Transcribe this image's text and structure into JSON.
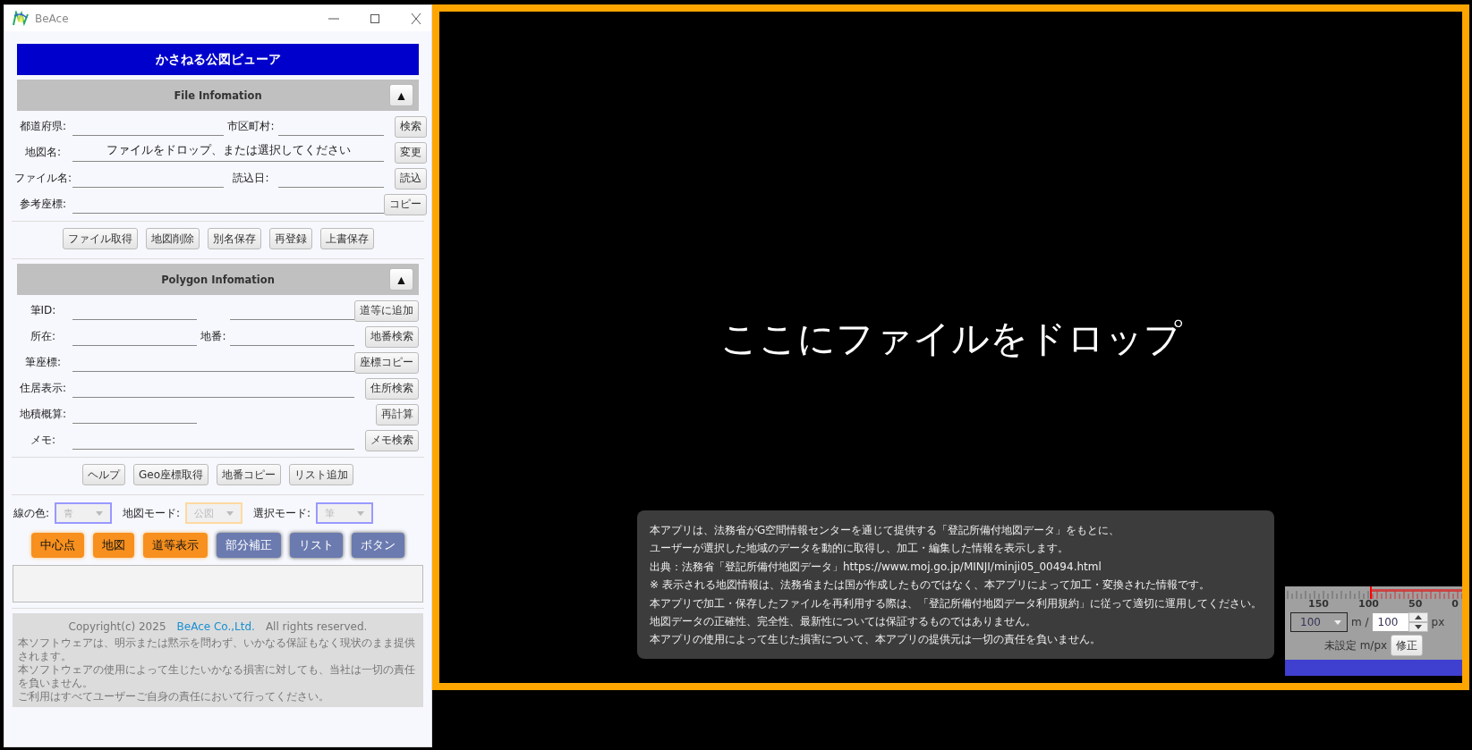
{
  "window": {
    "title": "BeAce"
  },
  "header": "かさねる公図ビューア",
  "sections": [
    {
      "title": "File Infomation",
      "toggle": "▲",
      "expanded": true,
      "rows": [
        {
          "kind": "pair",
          "label": "都道府県:",
          "label_2": "市区町村:",
          "button": "検索"
        },
        {
          "kind": "single",
          "label": "地図名:",
          "value": "ファイルをドロップ、または選択してください",
          "button": "変更"
        },
        {
          "kind": "pair",
          "label": "ファイル名:",
          "label_2": "読込日:",
          "button": "読込"
        },
        {
          "kind": "single",
          "label": "参考座標:",
          "button": "コピー"
        }
      ],
      "buttons": [
        "ファイル取得",
        "地図削除",
        "別名保存",
        "再登録",
        "上書保存"
      ]
    },
    {
      "title": "Polygon Infomation",
      "toggle": "▲",
      "expanded": true,
      "rows": [
        {
          "kind": "pair",
          "label": "筆ID:",
          "button": "道等に追加"
        },
        {
          "kind": "pair",
          "label": "所在:",
          "label_2": "地番:",
          "button": "地番検索"
        },
        {
          "kind": "single",
          "label": "筆座標:",
          "button": "座標コピー"
        },
        {
          "kind": "single",
          "label": "住居表示:",
          "button": "住所検索"
        },
        {
          "kind": "short",
          "label": "地積概算:",
          "button": "再計算"
        },
        {
          "kind": "single",
          "label": "メモ:",
          "button": "メモ検索"
        }
      ],
      "buttons": [
        "ヘルプ",
        "Geo座標取得",
        "地番コピー",
        "リスト追加"
      ]
    }
  ],
  "selectors": [
    {
      "label": "線の色:",
      "value": "青",
      "disabled": true,
      "color": "#9999ff"
    },
    {
      "label": "地図モード:",
      "value": "公図",
      "disabled": true,
      "color": "#ffd9a0"
    },
    {
      "label": "選択モード:",
      "value": "筆",
      "disabled": true,
      "color": "#9999ff"
    }
  ],
  "toggles": [
    {
      "label": "中心点",
      "on": true
    },
    {
      "label": "地図",
      "on": true
    },
    {
      "label": "道等表示",
      "on": true
    },
    {
      "label": "部分補正",
      "on": false
    },
    {
      "label": "リスト",
      "on": false
    },
    {
      "label": "ボタン",
      "on": false
    }
  ],
  "footer": {
    "copyright": "Copyright(c) 2025",
    "company": "BeAce Co.,Ltd.",
    "rights": "All rights reserved.",
    "notice": [
      "本ソフトウェアは、明示または黙示を問わず、いかなる保証もなく現状のまま提供されます。",
      "本ソフトウェアの使用によって生じたいかなる損害に対しても、当社は一切の責任を負いません。",
      "ご利用はすべてユーザーご自身の責任において行ってください。"
    ]
  },
  "drop_area": {
    "message": "ここにファイルをドロップ",
    "notice": [
      "本アプリは、法務省がG空間情報センターを通じて提供する「登記所備付地図データ」をもとに、",
      "ユーザーが選択した地域のデータを動的に取得し、加工・編集した情報を表示します。",
      "出典：法務省「登記所備付地図データ」https://www.moj.go.jp/MINJI/minji05_00494.html",
      "※ 表示される地図情報は、法務省または国が作成したものではなく、本アプリによって加工・変換された情報です。",
      "本アプリで加工・保存したファイルを再利用する際は、「登記所備付地図データ利用規約」に従って適切に運用してください。",
      "地図データの正確性、完全性、最新性については保証するものではありません。",
      "本アプリの使用によって生じた損害について、本アプリの提供元は一切の責任を負いません。"
    ]
  },
  "scale": {
    "ruler_labels": [
      "150",
      "100",
      "50",
      "0"
    ],
    "meters": "100",
    "meters_unit": "m /",
    "pixels": "100",
    "pixels_unit": "px",
    "status": "未設定 m/px",
    "button": "修正"
  }
}
